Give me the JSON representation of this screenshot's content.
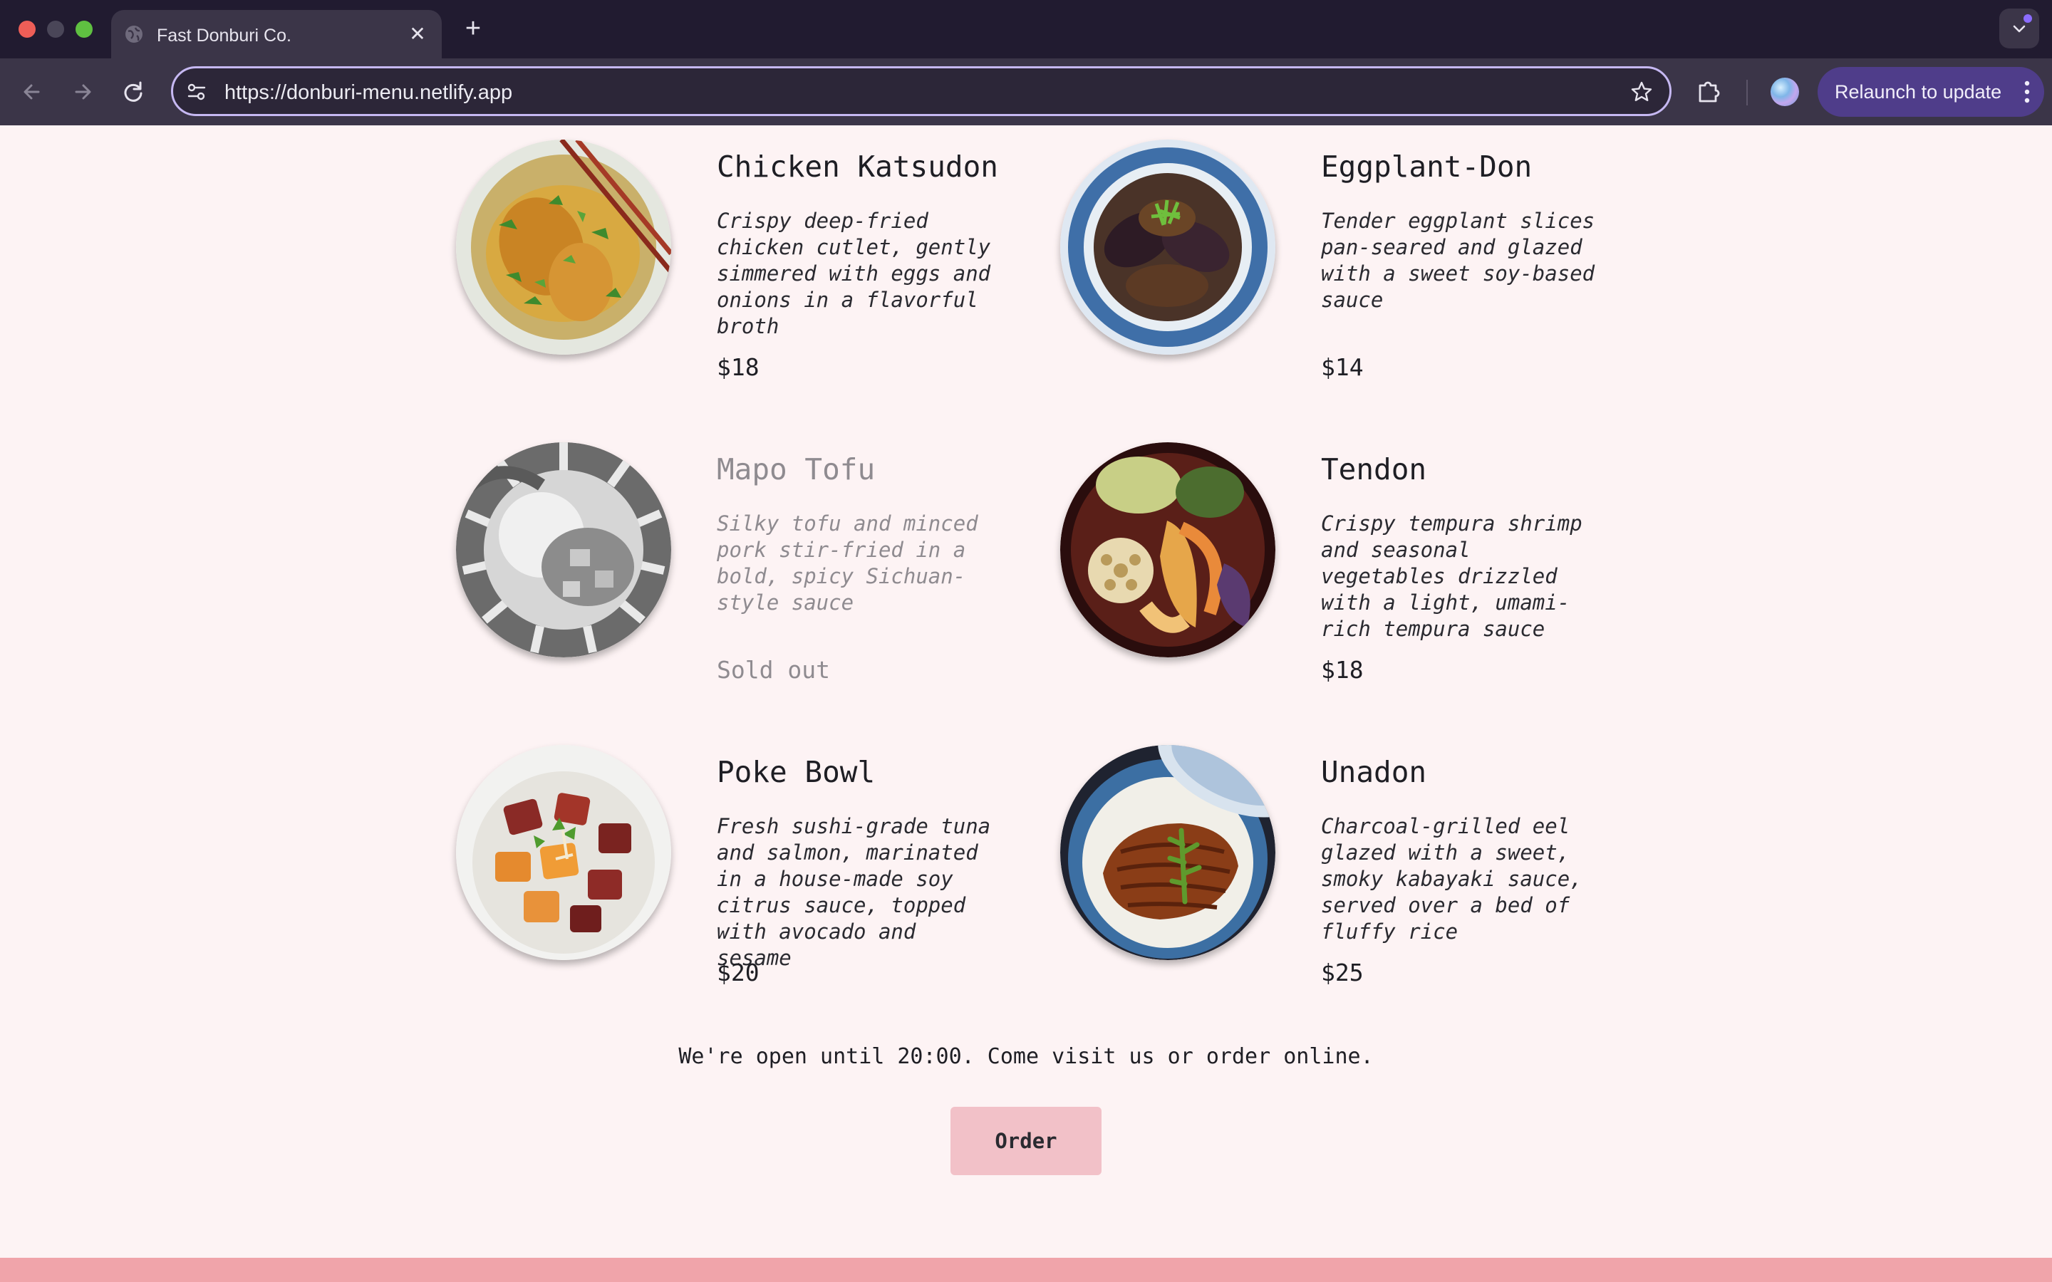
{
  "browser": {
    "tab_title": "Fast Donburi Co.",
    "url": "https://donburi-menu.netlify.app",
    "relaunch_label": "Relaunch to update"
  },
  "menu": {
    "items": [
      {
        "name": "Chicken Katsudon",
        "description": "Crispy deep-fried chicken cutlet, gently simmered with eggs and onions in a flavorful broth",
        "price": "$18",
        "sold_out": false
      },
      {
        "name": "Eggplant-Don",
        "description": "Tender eggplant slices pan-seared and glazed with a sweet soy-based sauce",
        "price": "$14",
        "sold_out": false
      },
      {
        "name": "Mapo Tofu",
        "description": "Silky tofu and minced pork stir-fried in a bold, spicy Sichuan-style sauce",
        "price": "Sold out",
        "sold_out": true
      },
      {
        "name": "Tendon",
        "description": "Crispy tempura shrimp and seasonal vegetables drizzled with a light, umami-rich tempura sauce",
        "price": "$18",
        "sold_out": false
      },
      {
        "name": "Poke Bowl",
        "description": "Fresh sushi-grade tuna and salmon, marinated in a house-made soy citrus sauce, topped with avocado and sesame",
        "price": "$20",
        "sold_out": false
      },
      {
        "name": "Unadon",
        "description": "Charcoal-grilled eel glazed with a sweet, smoky kabayaki sauce, served over a bed of fluffy rice",
        "price": "$25",
        "sold_out": false
      }
    ]
  },
  "footer": {
    "note": "We're open until 20:00. Come visit us or order online.",
    "order_label": "Order"
  },
  "colors": {
    "page_background": "#fdf3f4",
    "order_button": "#f2c1c8",
    "footer_band": "#f0a4aa",
    "sold_out_text": "#8f8b90"
  }
}
